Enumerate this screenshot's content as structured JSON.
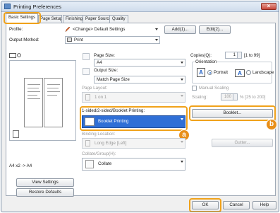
{
  "window": {
    "title": "Printing Preferences",
    "close_glyph": "×"
  },
  "tabs": [
    {
      "label": "Basic Settings"
    },
    {
      "label": "Page Setup"
    },
    {
      "label": "Finishing"
    },
    {
      "label": "Paper Source"
    },
    {
      "label": "Quality"
    }
  ],
  "profile": {
    "label": "Profile:",
    "value": "<Change> Default Settings",
    "add_label": "Add(1)...",
    "edit_label": "Edit(2)..."
  },
  "output_method": {
    "label": "Output Method:",
    "value": "Print"
  },
  "preview": {
    "caption": "A4 x2 -> A4"
  },
  "left_buttons": {
    "view_settings": "View Settings",
    "restore_defaults": "Restore Defaults"
  },
  "page_size": {
    "label": "Page Size:",
    "value": "A4"
  },
  "output_size": {
    "label": "Output Size:",
    "value": "Match Page Size"
  },
  "page_layout": {
    "label": "Page Layout:",
    "value": "1 on 1"
  },
  "duplex": {
    "label": "1-sided/2-sided/Booklet Printing:",
    "value": "Booklet Printing"
  },
  "binding": {
    "label": "Binding Location:",
    "value": "Long Edge [Left]"
  },
  "collate": {
    "label": "Collate/Group(H):",
    "value": "Collate"
  },
  "copies": {
    "label": "Copies(Q):",
    "value": "1",
    "range": "[1 to 99]"
  },
  "orientation": {
    "label": "Orientation",
    "portrait": "Portrait",
    "landscape": "Landscape",
    "glyph": "A"
  },
  "manual_scaling": {
    "label": "Manual Scaling"
  },
  "scaling": {
    "label": "Scaling:",
    "value": "100",
    "range": "% [25 to 200]"
  },
  "booklet_button": "Booklet...",
  "gutter_button": "Gutter...",
  "badges": {
    "a": "a",
    "b": "b"
  },
  "footer": {
    "ok": "OK",
    "cancel": "Cancel",
    "help": "Help"
  },
  "colors": {
    "highlight": "#f0a21a",
    "badge": "#e88f1a",
    "selected_row": "#2f6fd6"
  }
}
